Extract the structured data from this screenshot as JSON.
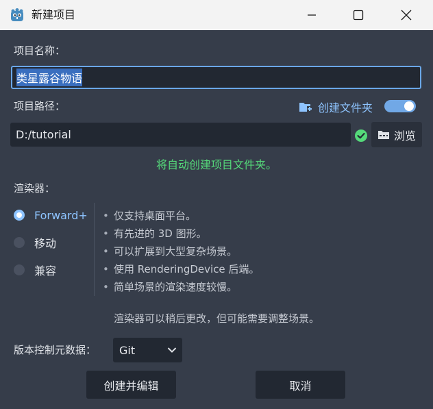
{
  "window": {
    "title": "新建项目",
    "icon": "godot-icon",
    "controls": [
      "minimize-icon",
      "maximize-icon",
      "close-icon"
    ]
  },
  "project_name": {
    "label": "项目名称：",
    "value": "类星露谷物语"
  },
  "project_path": {
    "label": "项目路径：",
    "value": "D:/tutorial",
    "create_folder_label": "创建文件夹",
    "create_folder_enabled": true,
    "browse_label": "浏览",
    "status": "将自动创建项目文件夹。"
  },
  "renderer": {
    "label": "渲染器：",
    "options": [
      {
        "label": "Forward+",
        "selected": true
      },
      {
        "label": "移动",
        "selected": false
      },
      {
        "label": "兼容",
        "selected": false
      }
    ],
    "features": [
      "仅支持桌面平台。",
      "有先进的 3D 图形。",
      "可以扩展到大型复杂场景。",
      "使用 RenderingDevice 后端。",
      "简单场景的渲染速度较慢。"
    ],
    "note": "渲染器可以稍后更改，但可能需要调整场景。"
  },
  "vcs": {
    "label": "版本控制元数据：",
    "selected": "Git"
  },
  "actions": {
    "create_label": "创建并编辑",
    "cancel_label": "取消"
  },
  "colors": {
    "background": "#363d4a",
    "input_bg": "#222832",
    "accent": "#8ec4ff",
    "success": "#55d97a",
    "titlebar": "#f3f3f3"
  }
}
